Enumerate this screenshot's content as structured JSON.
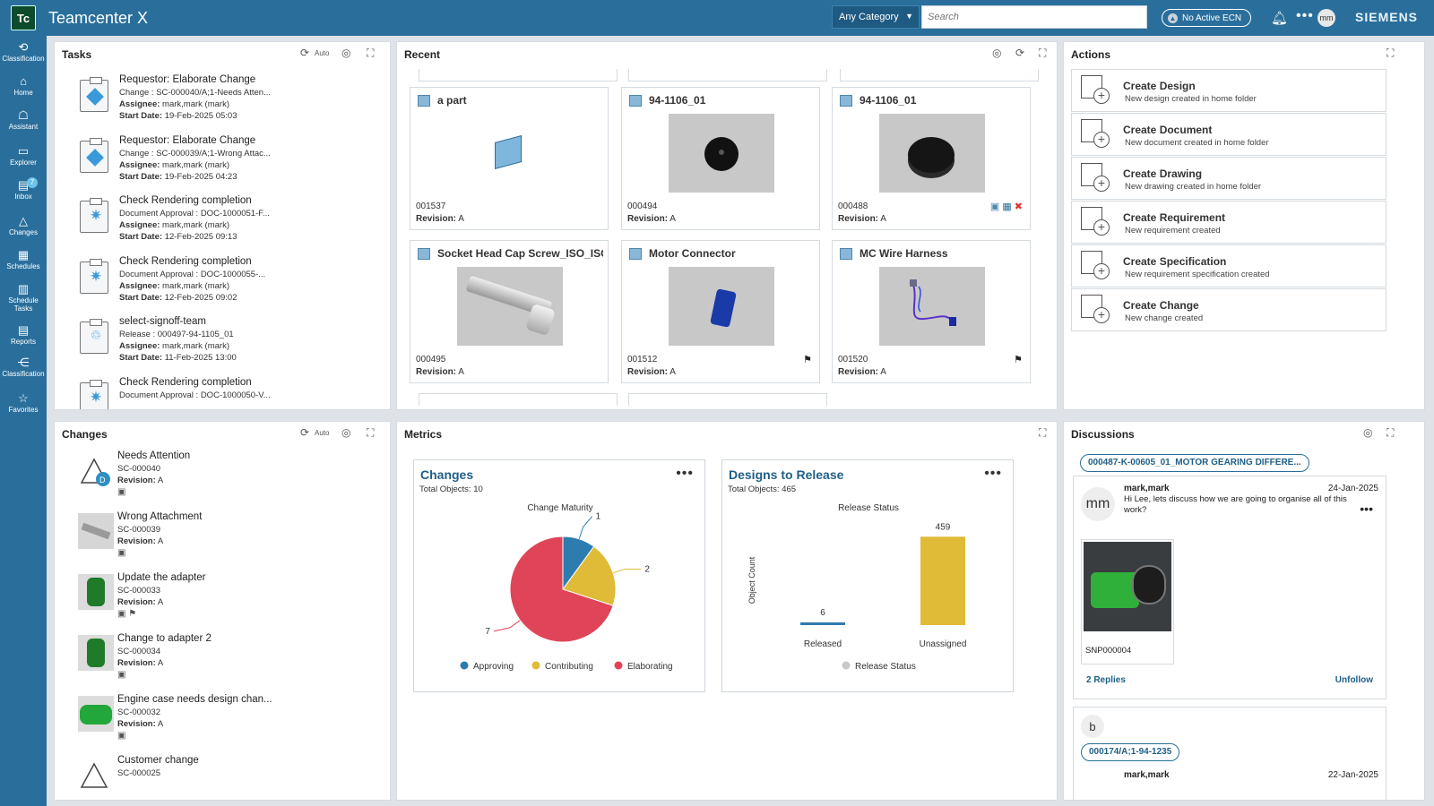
{
  "app": {
    "logo": "Tc",
    "title": "Teamcenter X",
    "brand": "SIEMENS"
  },
  "header": {
    "category": "Any Category",
    "search_placeholder": "Search",
    "ecn": "No Active ECN",
    "user_initials": "mm"
  },
  "nav": [
    {
      "label": "Classification",
      "icon": "classification-icon",
      "glyph": "⟲"
    },
    {
      "label": "Home",
      "icon": "home-icon",
      "glyph": "⌂"
    },
    {
      "label": "Assistant",
      "icon": "assistant-icon",
      "glyph": "☖"
    },
    {
      "label": "Explorer",
      "icon": "explorer-icon",
      "glyph": "▭"
    },
    {
      "label": "Inbox",
      "icon": "inbox-icon",
      "glyph": "▤",
      "badge": "7"
    },
    {
      "label": "Changes",
      "icon": "changes-icon",
      "glyph": "△"
    },
    {
      "label": "Schedules",
      "icon": "schedules-icon",
      "glyph": "▦"
    },
    {
      "label": "Schedule Tasks",
      "icon": "schedule-tasks-icon",
      "glyph": "▥"
    },
    {
      "label": "Reports",
      "icon": "reports-icon",
      "glyph": "▤"
    },
    {
      "label": "Classification",
      "icon": "classification-tree-icon",
      "glyph": "⋲"
    },
    {
      "label": "Favorites",
      "icon": "favorites-icon",
      "glyph": "☆"
    }
  ],
  "tasks": {
    "title": "Tasks",
    "auto_label": "Auto",
    "items": [
      {
        "name": "Requestor: Elaborate Change",
        "desc": "Change : SC-000040/A;1-Needs Atten...",
        "assignee_label": "Assignee:",
        "assignee": "mark,mark (mark)",
        "start_label": "Start Date:",
        "start": "19-Feb-2025 05:03",
        "icon": "diamond"
      },
      {
        "name": "Requestor: Elaborate Change",
        "desc": "Change : SC-000039/A;1-Wrong Attac...",
        "assignee_label": "Assignee:",
        "assignee": "mark,mark (mark)",
        "start_label": "Start Date:",
        "start": "19-Feb-2025 04:23",
        "icon": "diamond"
      },
      {
        "name": "Check Rendering completion",
        "desc": "Document Approval : DOC-1000051-F...",
        "assignee_label": "Assignee:",
        "assignee": "mark,mark (mark)",
        "start_label": "Start Date:",
        "start": "12-Feb-2025 09:13",
        "icon": "star"
      },
      {
        "name": "Check Rendering completion",
        "desc": "Document Approval : DOC-1000055-...",
        "assignee_label": "Assignee:",
        "assignee": "mark,mark (mark)",
        "start_label": "Start Date:",
        "start": "12-Feb-2025 09:02",
        "icon": "star"
      },
      {
        "name": "select-signoff-team",
        "desc": "Release : 000497-94-1105_01",
        "assignee_label": "Assignee:",
        "assignee": "mark,mark (mark)",
        "start_label": "Start Date:",
        "start": "11-Feb-2025 13:00",
        "icon": "team"
      },
      {
        "name": "Check Rendering completion",
        "desc": "Document Approval : DOC-1000050-V...",
        "assignee_label": "",
        "assignee": "",
        "start_label": "",
        "start": "",
        "icon": "star"
      }
    ]
  },
  "recent": {
    "title": "Recent",
    "rev_label": "Revision:",
    "tiles": [
      {
        "name": "a part",
        "id": "001537",
        "rev": "A"
      },
      {
        "name": "94-1106_01",
        "id": "000494",
        "rev": "A"
      },
      {
        "name": "94-1106_01",
        "id": "000488",
        "rev": "A"
      },
      {
        "name": "Socket Head Cap Screw_ISO_ISO ...",
        "id": "000495",
        "rev": "A"
      },
      {
        "name": "Motor Connector",
        "id": "001512",
        "rev": "A"
      },
      {
        "name": "MC Wire Harness",
        "id": "001520",
        "rev": "A"
      }
    ]
  },
  "actions": {
    "title": "Actions",
    "items": [
      {
        "name": "Create Design",
        "desc": "New design created in home folder",
        "icon": "create-design-icon"
      },
      {
        "name": "Create Document",
        "desc": "New document created in home folder",
        "icon": "create-document-icon"
      },
      {
        "name": "Create Drawing",
        "desc": "New drawing created in home folder",
        "icon": "create-drawing-icon"
      },
      {
        "name": "Create Requirement",
        "desc": "New requirement created",
        "icon": "create-requirement-icon"
      },
      {
        "name": "Create Specification",
        "desc": "New requirement specification created",
        "icon": "create-specification-icon"
      },
      {
        "name": "Create Change",
        "desc": "New change created",
        "icon": "create-change-icon"
      }
    ]
  },
  "changes": {
    "title": "Changes",
    "auto_label": "Auto",
    "rev_label": "Revision:",
    "items": [
      {
        "name": "Needs Attention",
        "id": "SC-000040",
        "rev": "A"
      },
      {
        "name": "Wrong Attachment",
        "id": "SC-000039",
        "rev": "A"
      },
      {
        "name": "Update the adapter",
        "id": "SC-000033",
        "rev": "A"
      },
      {
        "name": "Change to adapter 2",
        "id": "SC-000034",
        "rev": "A"
      },
      {
        "name": "Engine case needs design chan...",
        "id": "SC-000032",
        "rev": "A"
      },
      {
        "name": "Customer change",
        "id": "SC-000025",
        "rev": ""
      }
    ]
  },
  "metrics": {
    "title": "Metrics",
    "changes_card": {
      "title": "Changes",
      "total": "Total Objects: 10"
    },
    "designs_card": {
      "title": "Designs to Release",
      "total": "Total Objects: 465"
    }
  },
  "chart_data": [
    {
      "type": "pie",
      "title": "Change Maturity",
      "categories": [
        "Approving",
        "Contributing",
        "Elaborating"
      ],
      "values": [
        1,
        2,
        7
      ],
      "colors": [
        "#2d7cb0",
        "#e0bb38",
        "#e04458"
      ],
      "legend": "bottom"
    },
    {
      "type": "bar",
      "title": "Release Status",
      "categories": [
        "Released",
        "Unassigned"
      ],
      "values": [
        6,
        459
      ],
      "colors": [
        "#2d7cb0",
        "#e0bb38"
      ],
      "ylabel": "Object Count",
      "series": [
        {
          "name": "Release Status",
          "values": [
            6,
            459
          ]
        }
      ],
      "legend": "bottom"
    }
  ],
  "discussions": {
    "title": "Discussions",
    "thread1": {
      "chip": "000487-K-00605_01_MOTOR GEARING DIFFERE...",
      "author": "mark,mark",
      "date": "24-Jan-2025",
      "avatar": "mm",
      "message": "Hi Lee, lets discuss how we are going to organise all of this work?",
      "attachment": "SNP000004",
      "replies": "2 Replies",
      "unfollow": "Unfollow"
    },
    "thread2": {
      "avatar": "b",
      "chip": "000174/A;1-94-1235",
      "author": "mark,mark",
      "date": "22-Jan-2025"
    }
  },
  "colors": {
    "accent": "#2a6f9c",
    "link": "#1f5f86",
    "approving": "#2d7cb0",
    "contributing": "#e0bb38",
    "elaborating": "#e04458"
  }
}
